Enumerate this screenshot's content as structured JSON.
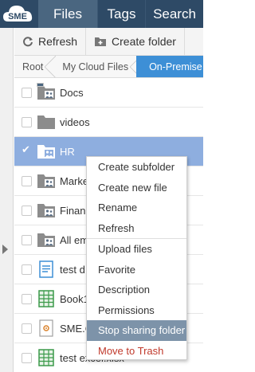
{
  "nav": {
    "logo_text": "SME",
    "tabs": [
      "Files",
      "Tags",
      "Search"
    ]
  },
  "toolbar": {
    "refresh_label": "Refresh",
    "create_folder_label": "Create folder"
  },
  "breadcrumb": [
    "Root",
    "My Cloud Files",
    "On-Premise"
  ],
  "files": [
    {
      "name": "Docs",
      "icon": "shared-folder-icon",
      "selected": false
    },
    {
      "name": "videos",
      "icon": "folder-icon",
      "selected": false
    },
    {
      "name": "HR",
      "icon": "shared-folder-icon",
      "selected": true
    },
    {
      "name": "Marke",
      "icon": "shared-folder-icon",
      "selected": false
    },
    {
      "name": "Financ",
      "icon": "shared-folder-icon",
      "selected": false
    },
    {
      "name": "All em",
      "icon": "shared-folder-icon",
      "selected": false
    },
    {
      "name": "test d",
      "icon": "document-icon",
      "selected": false
    },
    {
      "name": "Book1",
      "icon": "spreadsheet-icon",
      "selected": false
    },
    {
      "name": "SME.C",
      "icon": "file-icon",
      "selected": false
    },
    {
      "name": "test excel.xlsx",
      "icon": "spreadsheet-icon",
      "selected": false
    }
  ],
  "context_menu": {
    "group1": [
      "Create subfolder",
      "Create new file",
      "Rename",
      "Refresh"
    ],
    "group2": [
      "Upload files",
      "Favorite",
      "Description",
      "Permissions",
      "Stop sharing folder",
      "Move to Trash"
    ],
    "highlighted": "Stop sharing folder",
    "danger": "Move to Trash"
  },
  "colors": {
    "nav_bg": "#2e4a66",
    "nav_active": "#4a6680",
    "breadcrumb_active": "#3d8fd6",
    "selected_row": "#8eaedf",
    "menu_highlight": "#7d93a9",
    "danger_text": "#c0392b"
  }
}
